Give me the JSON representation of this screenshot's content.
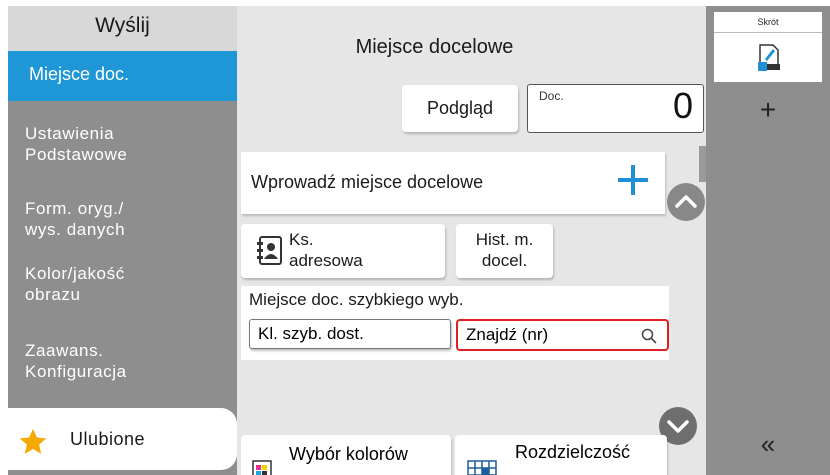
{
  "nav": {
    "header": "Wyślij",
    "items": [
      {
        "lines": [
          "Miejsce doc."
        ],
        "active": true
      },
      {
        "lines": [
          "Ustawienia",
          "Podstawowe"
        ],
        "active": false
      },
      {
        "lines": [
          "Form. oryg./",
          "wys. danych"
        ],
        "active": false
      },
      {
        "lines": [
          "Kolor/jakość",
          "obrazu"
        ],
        "active": false
      },
      {
        "lines": [
          "Zaawans.",
          "Konfiguracja"
        ],
        "active": false
      }
    ],
    "favorites": "Ulubione"
  },
  "main": {
    "title": "Miejsce docelowe",
    "preview_label": "Podgląd",
    "doc_label": "Doc.",
    "doc_count": "0",
    "enter_dest": "Wprowadź miejsce docelowe",
    "address_book": [
      "Ks.",
      "adresowa"
    ],
    "history": [
      "Hist. m.",
      "docel."
    ],
    "speed_dial_title": "Miejsce doc. szybkiego wyb.",
    "speed_dial_button": "Kl. szyb. dost.",
    "find_placeholder": "Znajdź (nr)",
    "color_select": "Wybór kolorów",
    "resolution": "Rozdzielczość"
  },
  "shortcut": {
    "header": "Skrót",
    "add": "+",
    "collapse": "«"
  },
  "colors": {
    "active_nav": "#1f97d6",
    "nav_bg": "#8e8e8e",
    "highlight_border": "#e02020",
    "plus_blue": "#1f8fd6"
  }
}
